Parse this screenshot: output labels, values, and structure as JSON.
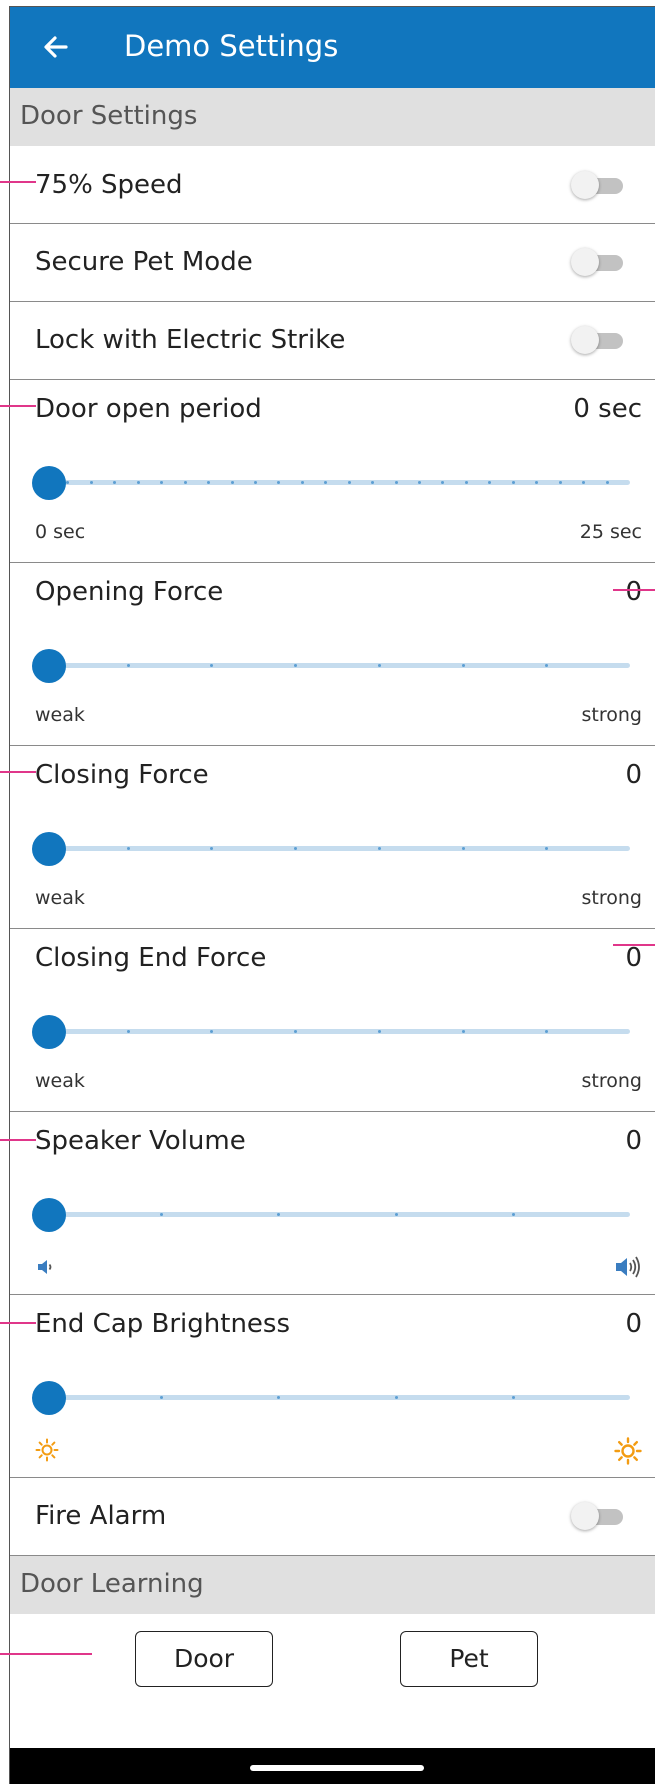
{
  "app_bar": {
    "title": "Demo Settings",
    "back_icon": "arrow-left-icon"
  },
  "sections": {
    "door_settings": "Door Settings",
    "door_learning": "Door Learning"
  },
  "toggles": {
    "speed": {
      "label": "75% Speed",
      "on": false
    },
    "secure_pet": {
      "label": "Secure Pet Mode",
      "on": false
    },
    "electric_strike": {
      "label": "Lock with Electric Strike",
      "on": false
    },
    "fire_alarm": {
      "label": "Fire Alarm",
      "on": false
    }
  },
  "sliders": {
    "door_open_period": {
      "label": "Door open period",
      "value_text": "0 sec",
      "value": 0,
      "min_label": "0 sec",
      "max_label": "25 sec"
    },
    "opening_force": {
      "label": "Opening Force",
      "value_text": "0",
      "value": 0,
      "min_label": "weak",
      "max_label": "strong"
    },
    "closing_force": {
      "label": "Closing Force",
      "value_text": "0",
      "value": 0,
      "min_label": "weak",
      "max_label": "strong"
    },
    "closing_end_force": {
      "label": "Closing End Force",
      "value_text": "0",
      "value": 0,
      "min_label": "weak",
      "max_label": "strong"
    },
    "speaker_volume": {
      "label": "Speaker Volume",
      "value_text": "0",
      "value": 0,
      "min_icon": "speaker-low-icon",
      "max_icon": "speaker-high-icon"
    },
    "end_cap_brightness": {
      "label": "End Cap Brightness",
      "value_text": "0",
      "value": 0,
      "min_icon": "sun-dim-icon",
      "max_icon": "sun-bright-icon"
    }
  },
  "buttons": {
    "door": "Door",
    "pet": "Pet"
  },
  "colors": {
    "primary": "#1176be",
    "track": "#c5dcee",
    "section_bg": "#e0e0e0",
    "toggle_off": "#c2c2c2",
    "brightness": "#f39c12",
    "annotation": "#e0368a"
  }
}
